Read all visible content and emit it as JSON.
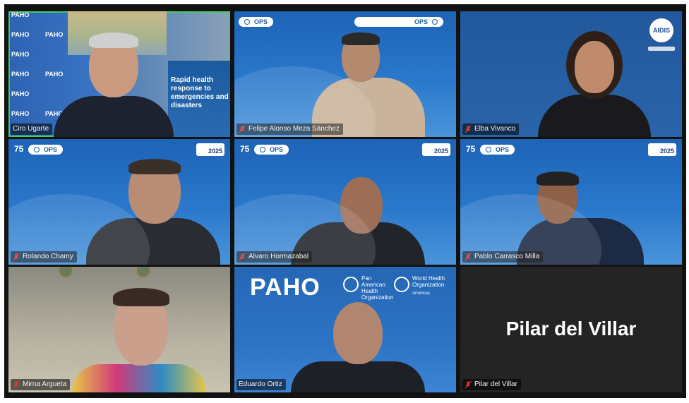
{
  "participants": [
    {
      "name": "Ciro Ugarte",
      "active": true,
      "big_label": ""
    },
    {
      "name": "Felipe Alonso Meza Sánchez",
      "active": false,
      "big_label": ""
    },
    {
      "name": "Elba Vivanco",
      "active": false,
      "big_label": ""
    },
    {
      "name": "Rolando Chamy",
      "active": false,
      "big_label": ""
    },
    {
      "name": "Alvaro Hormazabal",
      "active": false,
      "big_label": ""
    },
    {
      "name": "Pablo Carrasco Milla",
      "active": false,
      "big_label": ""
    },
    {
      "name": "Mirna Argueta",
      "active": false,
      "big_label": ""
    },
    {
      "name": "Eduardo Ortiz",
      "active": false,
      "big_label": ""
    },
    {
      "name": "Pilar del Villar",
      "active": false,
      "big_label": "Pilar del Villar"
    }
  ],
  "backgrounds": {
    "wall_logo": "PAHO",
    "poster_text": "Rapid health response to emergencies and disasters",
    "ops_logo": "OPS",
    "anniversary": "75",
    "year_badge": "2025",
    "paho_word": "PAHO",
    "paho_sub": "Pan American Health Organization",
    "who_sub": "World Health Organization",
    "who_region": "Americas",
    "aidis_logo": "AIDIS"
  },
  "colors": {
    "active_border": "#43c96a",
    "tile_blue": "#1d63b6",
    "muted_mic": "#e03a3a"
  },
  "icons": {
    "muted": "microphone-muted-icon"
  }
}
